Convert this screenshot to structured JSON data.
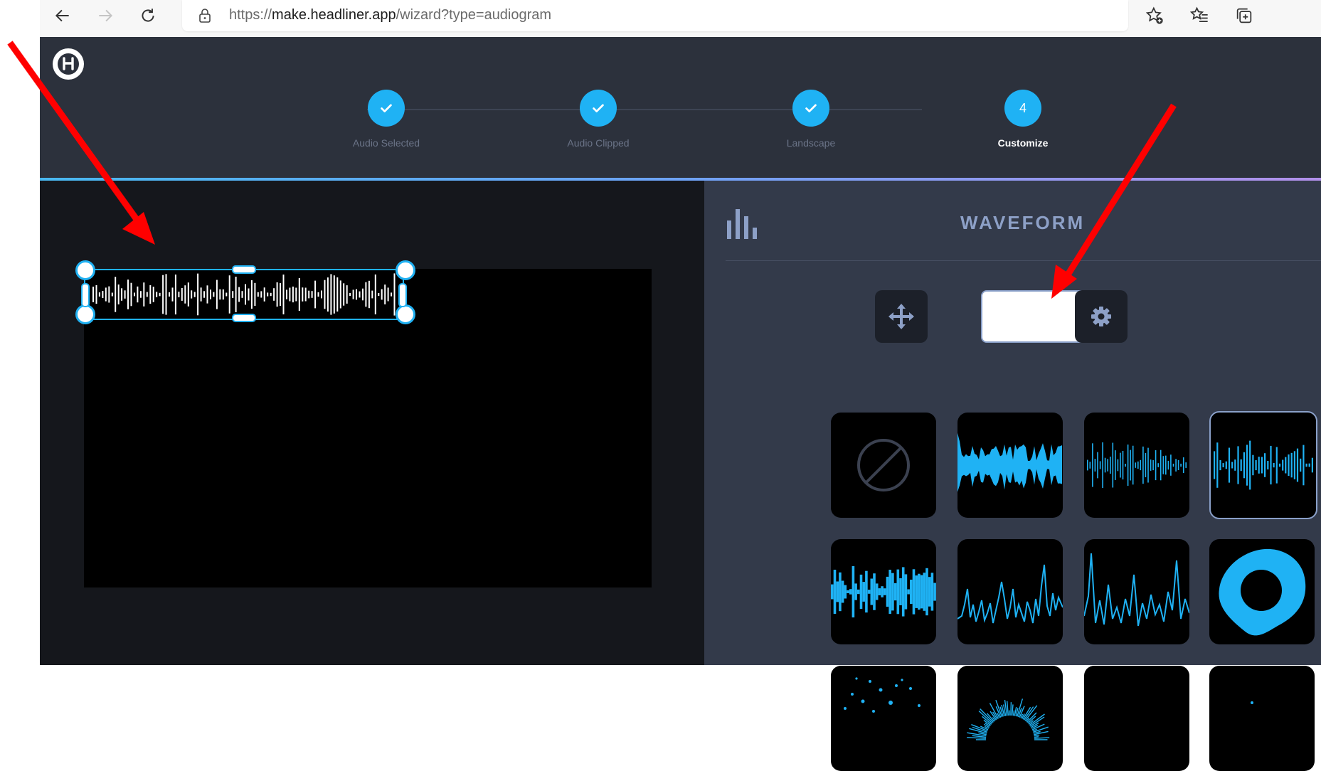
{
  "browser": {
    "url_prefix": "https://",
    "url_domain": "make.headliner.app",
    "url_path": "/wizard?type=audiogram"
  },
  "wizard": {
    "steps": [
      {
        "label": "Audio Selected",
        "state": "done"
      },
      {
        "label": "Audio Clipped",
        "state": "done"
      },
      {
        "label": "Landscape",
        "state": "done"
      },
      {
        "label": "Customize",
        "number": "4",
        "state": "active"
      }
    ]
  },
  "panel": {
    "title": "WAVEFORM",
    "color_swatch": "#ffffff",
    "styles": [
      {
        "name": "none",
        "icon": "no-waveform-icon"
      },
      {
        "name": "wave-fill",
        "icon": "wave-fill-icon"
      },
      {
        "name": "bars-thin",
        "icon": "bars-thin-icon"
      },
      {
        "name": "bars-selected",
        "icon": "bars-selected-icon",
        "selected": true
      },
      {
        "name": "bars-blocky",
        "icon": "bars-blocky-icon"
      },
      {
        "name": "line-wave",
        "icon": "line-wave-icon"
      },
      {
        "name": "line-jagged",
        "icon": "line-jagged-icon"
      },
      {
        "name": "blob",
        "icon": "blob-icon"
      },
      {
        "name": "dots",
        "icon": "dots-icon"
      },
      {
        "name": "radial",
        "icon": "radial-icon"
      },
      {
        "name": "empty-a",
        "icon": "empty-tile-icon"
      },
      {
        "name": "dots-b",
        "icon": "dots-icon"
      }
    ]
  },
  "colors": {
    "accent": "#1fb2f4",
    "app_bg": "#2c313c",
    "panel_bg": "#333a4a",
    "annotation_arrow": "#ff0000"
  }
}
